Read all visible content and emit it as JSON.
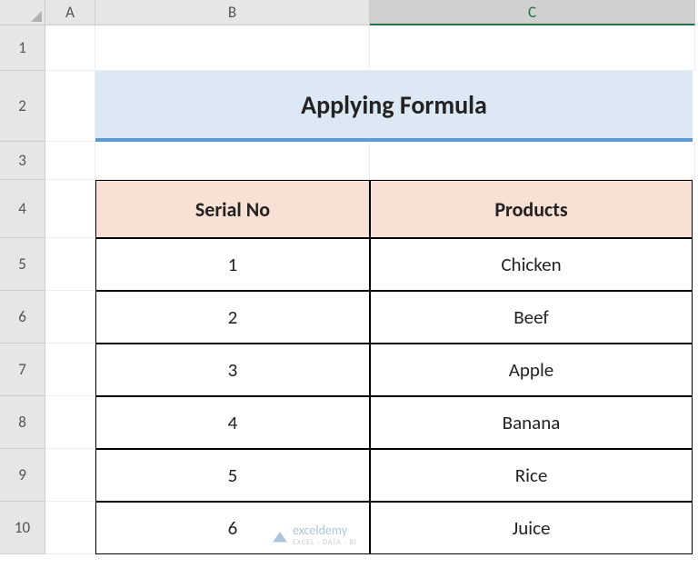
{
  "columns": [
    "A",
    "B",
    "C"
  ],
  "rows": [
    "1",
    "2",
    "3",
    "4",
    "5",
    "6",
    "7",
    "8",
    "9",
    "10"
  ],
  "active_column": "C",
  "title": "Applying Formula",
  "headers": {
    "serial": "Serial No",
    "products": "Products"
  },
  "data": [
    {
      "serial": "1",
      "product": "Chicken"
    },
    {
      "serial": "2",
      "product": "Beef"
    },
    {
      "serial": "3",
      "product": "Apple"
    },
    {
      "serial": "4",
      "product": "Banana"
    },
    {
      "serial": "5",
      "product": "Rice"
    },
    {
      "serial": "6",
      "product": "Juice"
    }
  ],
  "watermark": {
    "name": "exceldemy",
    "sub": "EXCEL · DATA · BI"
  }
}
